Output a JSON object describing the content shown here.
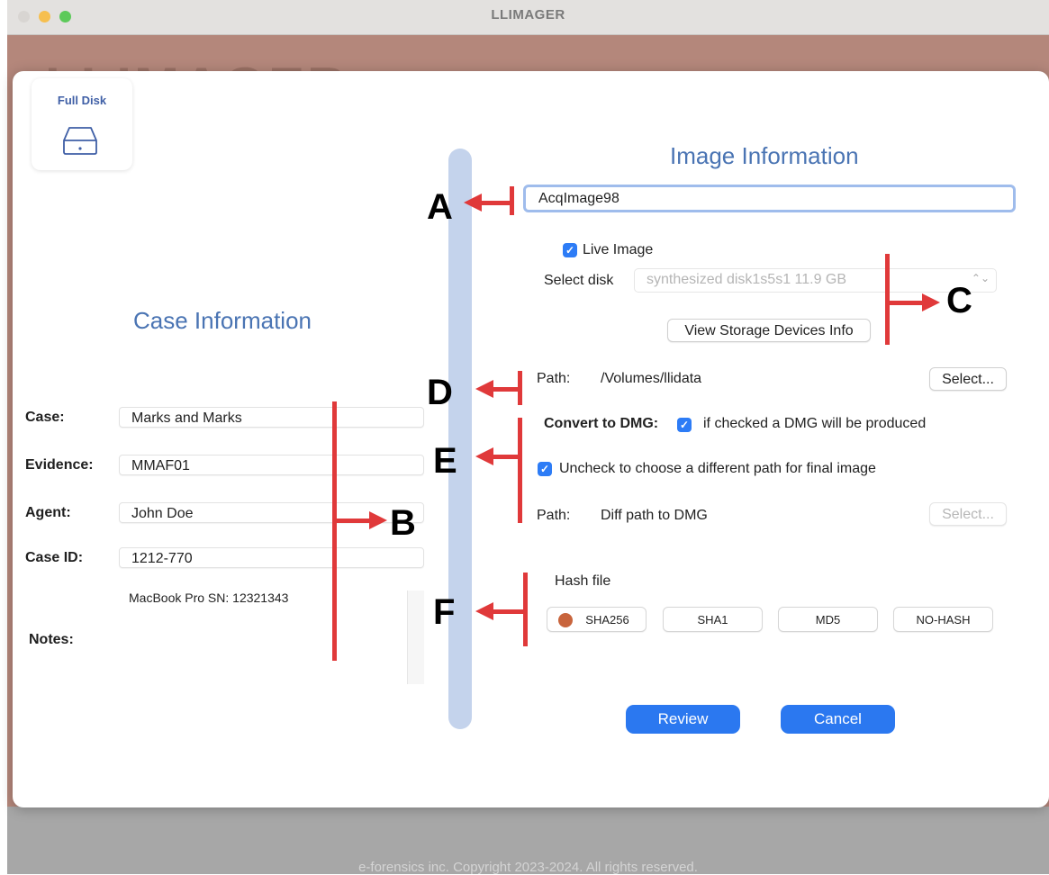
{
  "window": {
    "title": "LLIMAGER",
    "background_logo": "LLIMAGER",
    "footer": "e-forensics inc. Copyright 2023-2024. All rights reserved."
  },
  "mode_tile": {
    "label": "Full Disk",
    "icon": "hard-drive-icon"
  },
  "case_info": {
    "heading": "Case Information",
    "fields": [
      {
        "label": "Case:",
        "value": "Marks and Marks"
      },
      {
        "label": "Evidence:",
        "value": "MMAF01"
      },
      {
        "label": "Agent:",
        "value": "John Doe"
      },
      {
        "label": "Case ID:",
        "value": "1212-770"
      }
    ],
    "notes_label": "Notes:",
    "notes_value": "MacBook Pro SN: 12321343"
  },
  "image_info": {
    "heading": "Image Information",
    "image_name": "AcqImage98",
    "live_image_label": "Live Image",
    "live_image_checked": true,
    "select_disk_label": "Select disk",
    "select_disk_value": "synthesized disk1s5s1  11.9 GB",
    "storage_info_button": "View Storage Devices Info",
    "path_label": "Path:",
    "path_value": "/Volumes/llidata",
    "select_button": "Select...",
    "convert_label": "Convert to DMG:",
    "convert_checked": true,
    "convert_desc": "if checked a DMG will be produced",
    "diff_path_label": "Uncheck to choose a different path for final image",
    "diff_path_checked": true,
    "dmg_path_label": "Path:",
    "dmg_path_value": "Diff path to DMG",
    "dmg_select_button": "Select...",
    "hash_label": "Hash file",
    "hash_options": [
      "SHA256",
      "SHA1",
      "MD5",
      "NO-HASH"
    ],
    "hash_selected": "SHA256"
  },
  "actions": {
    "review": "Review",
    "cancel": "Cancel"
  },
  "annotations": {
    "a": "A",
    "b": "B",
    "c": "C",
    "d": "D",
    "e": "E",
    "f": "F"
  },
  "colors": {
    "annotation": "#e0393a",
    "accent": "#2b78f0",
    "heading": "#4a74b3",
    "window_bg": "#b4877b",
    "selected_radio": "#c8643c"
  }
}
